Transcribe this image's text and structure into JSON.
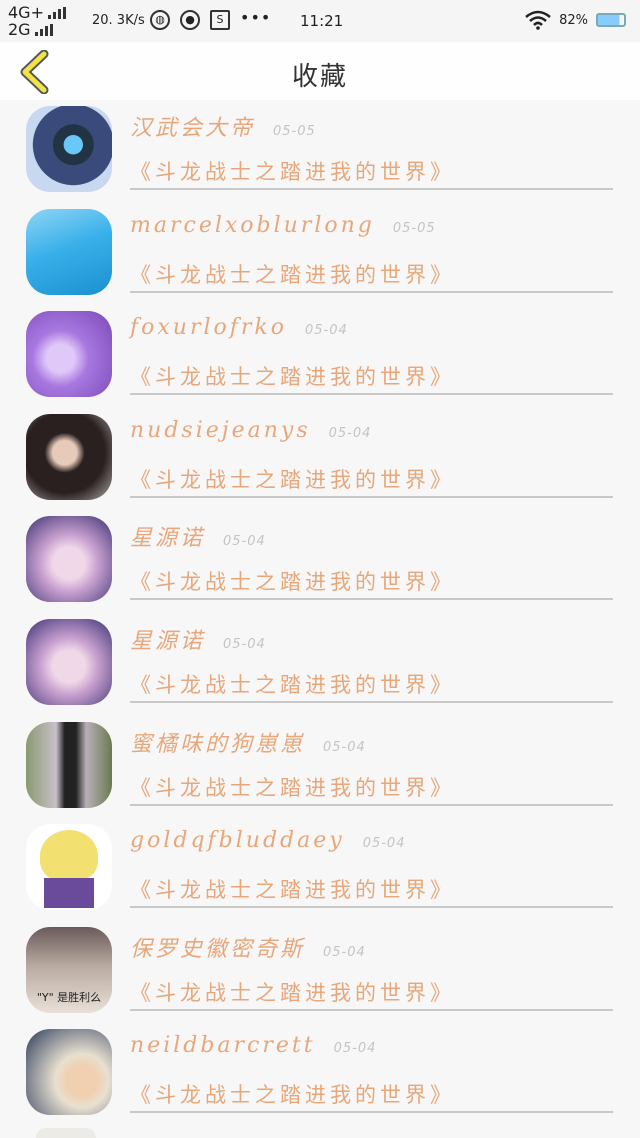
{
  "status_bar": {
    "network_top": "4G+",
    "network_bottom": "2G",
    "speed": "20. 3K/s",
    "time": "11:21",
    "battery": "82%"
  },
  "header": {
    "title": "收藏"
  },
  "favorites": [
    {
      "name": "汉武会大帝",
      "date": "05-05",
      "work": "《斗龙战士之踏进我的世界》",
      "avatar_colors": [
        "#2a3a6a",
        "#5aa8e8"
      ]
    },
    {
      "name": "marcelxoblurlong",
      "date": "05-05",
      "work": "《斗龙战士之踏进我的世界》",
      "avatar_colors": [
        "#1aa0e0",
        "#8fd6f5"
      ]
    },
    {
      "name": "foxurlofrko",
      "date": "05-04",
      "work": "《斗龙战士之踏进我的世界》",
      "avatar_colors": [
        "#8a5cc8",
        "#d0b0f0"
      ]
    },
    {
      "name": "nudsiejeanys",
      "date": "05-04",
      "work": "《斗龙战士之踏进我的世界》",
      "avatar_colors": [
        "#2a2020",
        "#b89a8a"
      ]
    },
    {
      "name": "星源诺",
      "date": "05-04",
      "work": "《斗龙战士之踏进我的世界》",
      "avatar_colors": [
        "#4a3a80",
        "#e0b8d8"
      ]
    },
    {
      "name": "星源诺",
      "date": "05-04",
      "work": "《斗龙战士之踏进我的世界》",
      "avatar_colors": [
        "#4a3a80",
        "#e0b8d8"
      ]
    },
    {
      "name": "蜜橘味的狗崽崽",
      "date": "05-04",
      "work": "《斗龙战士之踏进我的世界》",
      "avatar_colors": [
        "#6a7a50",
        "#c0b8c0"
      ]
    },
    {
      "name": "goldqfbluddaey",
      "date": "05-04",
      "work": "《斗龙战士之踏进我的世界》",
      "avatar_colors": [
        "#f0e060",
        "#6a4a9a"
      ]
    },
    {
      "name": "保罗史徽密奇斯",
      "date": "05-04",
      "work": "《斗龙战士之踏进我的世界》",
      "avatar_colors": [
        "#7a6a6a",
        "#d8d0c8"
      ]
    },
    {
      "name": "neildbarcrett",
      "date": "05-04",
      "work": "《斗龙战士之踏进我的世界》",
      "avatar_colors": [
        "#3a4a6a",
        "#e8c8a0"
      ]
    }
  ],
  "avatar_overlays": {
    "item_9": "\"Y\" 是胜利么"
  }
}
